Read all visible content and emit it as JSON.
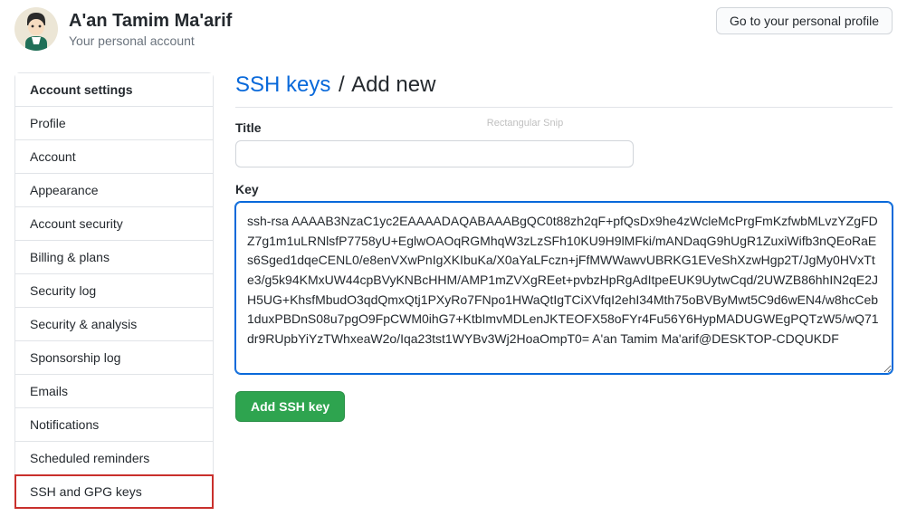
{
  "user": {
    "name": "A'an Tamim Ma'arif",
    "subtitle": "Your personal account"
  },
  "header": {
    "profile_button": "Go to your personal profile"
  },
  "sidebar": {
    "header": "Account settings",
    "items": [
      {
        "label": "Profile"
      },
      {
        "label": "Account"
      },
      {
        "label": "Appearance"
      },
      {
        "label": "Account security"
      },
      {
        "label": "Billing & plans"
      },
      {
        "label": "Security log"
      },
      {
        "label": "Security & analysis"
      },
      {
        "label": "Sponsorship log"
      },
      {
        "label": "Emails"
      },
      {
        "label": "Notifications"
      },
      {
        "label": "Scheduled reminders"
      },
      {
        "label": "SSH and GPG keys"
      }
    ]
  },
  "page": {
    "title_link": "SSH keys",
    "title_separator": "/",
    "title_sub": "Add new",
    "overlay_hint": "Rectangular Snip"
  },
  "form": {
    "title_label": "Title",
    "title_value": "",
    "key_label": "Key",
    "key_value": "ssh-rsa AAAAB3NzaC1yc2EAAAADAQABAAABgQC0t88zh2qF+pfQsDx9he4zWcleMcPrgFmKzfwbMLvzYZgFDZ7g1m1uLRNlsfP7758yU+EglwOAOqRGMhqW3zLzSFh10KU9H9lMFki/mANDaqG9hUgR1ZuxiWifb3nQEoRaEs6Sged1dqeCENL0/e8enVXwPnIgXKIbuKa/X0aYaLFczn+jFfMWWawvUBRKG1EVeShXzwHgp2T/JgMy0HVxTte3/g5k94KMxUW44cpBVyKNBcHHM/AMP1mZVXgREet+pvbzHpRgAdItpeEUK9UytwCqd/2UWZB86hhIN2qE2JH5UG+KhsfMbudO3qdQmxQtj1PXyRo7FNpo1HWaQtIgTCiXVfqI2ehI34Mth75oBVByMwt5C9d6wEN4/w8hcCeb1duxPBDnS08u7pgO9FpCWM0ihG7+KtbImvMDLenJKTEOFX58oFYr4Fu56Y6HypMADUGWEgPQTzW5/wQ71dr9RUpbYiYzTWhxeaW2o/Iqa23tst1WYBv3Wj2HoaOmpT0= A'an Tamim Ma'arif@DESKTOP-CDQUKDF",
    "submit_label": "Add SSH key"
  }
}
